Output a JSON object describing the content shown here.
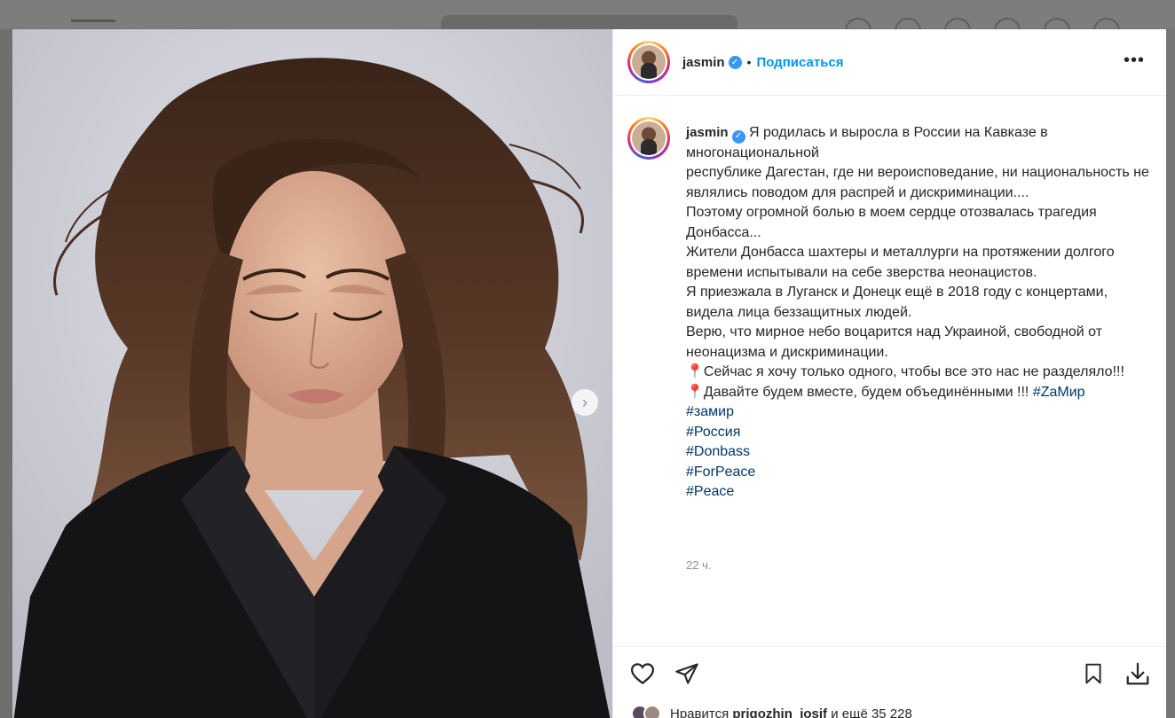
{
  "post": {
    "username": "jasmin",
    "verified_mark": "✓",
    "separator": "•",
    "follow_label": "Подписаться",
    "more_label": "•••",
    "caption_lines": [
      "Я родилась и выросла в России на Кавказе в многонациональной",
      "республике Дагестан, где ни вероисповедание, ни национальность не являлись поводом для распрей и дискриминации....",
      "Поэтому огромной болью в моем сердце отозвалась трагедия Донбасса...",
      "Жители Донбасса шахтеры и металлурги на протяжении долгого времени испытывали на себе зверства неонацистов.",
      "Я приезжала в Луганск и Донецк ещё в 2018 году с концертами, видела лица беззащитных людей.",
      "Верю, что мирное небо воцарится над Украиной, свободной от неонацизма и дискриминации.",
      "📍Сейчас я хочу только одного, чтобы все это нас не разделяло!!!",
      "📍Давайте будем вместе, будем объединёнными !!!"
    ],
    "hashtag_inline": "#ZaМир",
    "hashtags": [
      "#замир",
      "#Россия",
      "#Donbass",
      "#ForPeace",
      "#Peace"
    ],
    "timestamp": "22 ч.",
    "likes_prefix": "Нравится",
    "likes_user": "prigozhin_iosif",
    "likes_suffix": "и ещё 35 228"
  },
  "media": {
    "next_arrow": "›"
  },
  "icons": {
    "like": "heart-icon",
    "share": "send-icon",
    "save": "bookmark-icon",
    "download": "download-icon"
  },
  "colors": {
    "link": "#0095f6",
    "hashtag": "#00376b",
    "text": "#262626",
    "muted": "#8e8e8e"
  }
}
